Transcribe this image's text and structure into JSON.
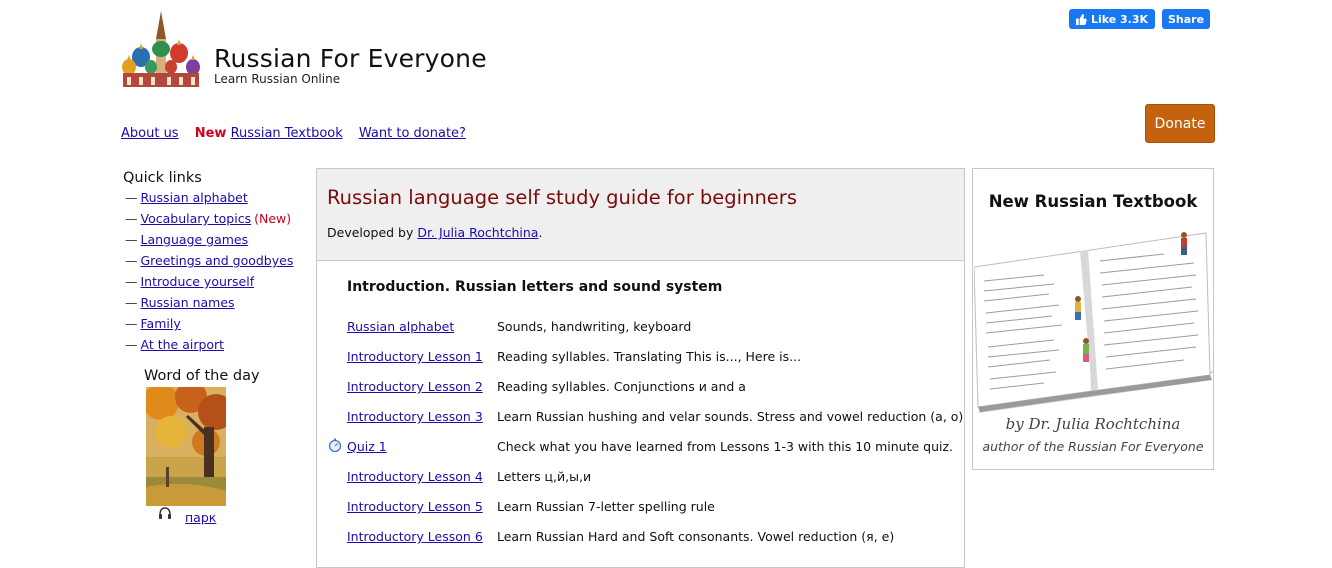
{
  "header": {
    "site_title": "Russian For Everyone",
    "tagline": "Learn Russian Online"
  },
  "social": {
    "like_label": "Like 3.3K",
    "share_label": "Share",
    "color": "#1877f2"
  },
  "nav": {
    "about": "About us",
    "new_tag": "New",
    "textbook": "Russian Textbook",
    "donate_link": "Want to donate?"
  },
  "donate_button": {
    "label": "Donate",
    "color": "#c5620f"
  },
  "sidebar": {
    "quick_links_title": "Quick links",
    "items": [
      {
        "label": "Russian alphabet",
        "tag": ""
      },
      {
        "label": "Vocabulary topics",
        "tag": "(New)"
      },
      {
        "label": "Language games",
        "tag": ""
      },
      {
        "label": "Greetings and goodbyes",
        "tag": ""
      },
      {
        "label": "Introduce yourself",
        "tag": ""
      },
      {
        "label": "Russian names",
        "tag": ""
      },
      {
        "label": "Family",
        "tag": ""
      },
      {
        "label": "At the airport",
        "tag": ""
      }
    ],
    "dash": "—",
    "word_of_day_title": "Word of the day",
    "word_of_day": "парк"
  },
  "main": {
    "title": "Russian language self study guide for beginners",
    "developed_by": "Developed by",
    "author": "Dr. Julia Rochtchina",
    "author_suffix": ".",
    "section_title": "Introduction. Russian letters and sound system",
    "lessons": [
      {
        "link": "Russian alphabet",
        "desc": "Sounds, handwriting, keyboard",
        "icon": ""
      },
      {
        "link": "Introductory Lesson 1",
        "desc": "Reading syllables. Translating This is..., Here is...",
        "icon": ""
      },
      {
        "link": "Introductory Lesson 2",
        "desc": "Reading syllables. Conjunctions и and а",
        "icon": ""
      },
      {
        "link": "Introductory Lesson 3",
        "desc": "Learn Russian hushing and velar sounds. Stress and vowel reduction (а, о)",
        "icon": ""
      },
      {
        "link": "Quiz 1",
        "desc": "Check what you have learned from Lessons 1-3 with this 10 minute quiz.",
        "icon": "stopwatch-icon"
      },
      {
        "link": "Introductory Lesson 4",
        "desc": "Letters ц,й,ы,и",
        "icon": ""
      },
      {
        "link": "Introductory Lesson 5",
        "desc": "Learn Russian 7-letter spelling rule",
        "icon": ""
      },
      {
        "link": "Introductory Lesson 6",
        "desc": "Learn Russian Hard and Soft consonants. Vowel reduction (я, е)",
        "icon": ""
      }
    ]
  },
  "book_card": {
    "title": "New Russian Textbook",
    "author": "by Dr. Julia Rochtchina",
    "subtitle": "author of the Russian For Everyone"
  }
}
